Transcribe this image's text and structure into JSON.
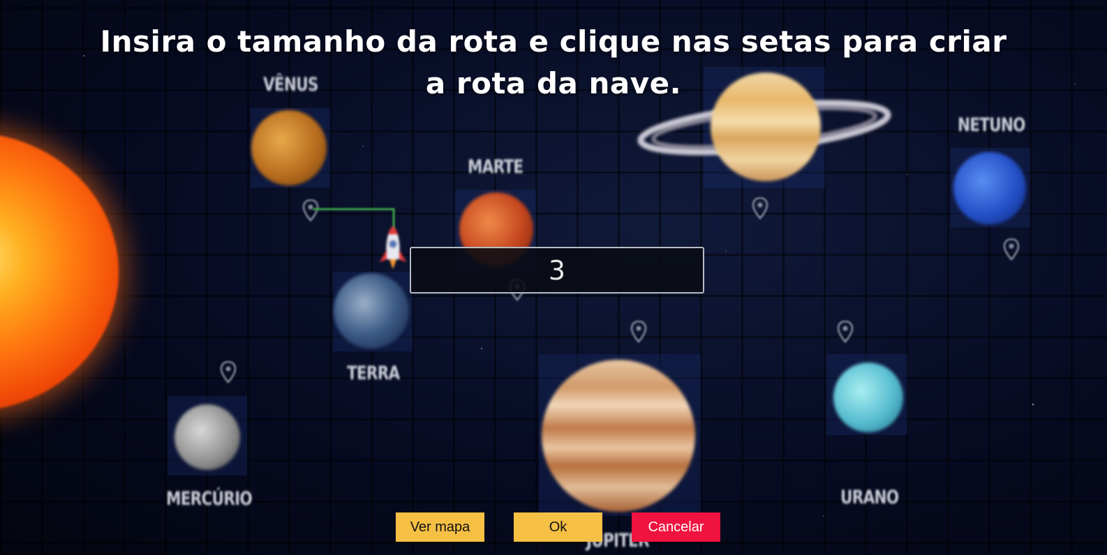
{
  "instruction": {
    "line1": "Insira o tamanho da rota e clique nas setas para criar",
    "line2": "a rota da nave."
  },
  "route_input": {
    "value": "3"
  },
  "buttons": {
    "map": "Ver mapa",
    "ok": "Ok",
    "cancel": "Cancelar"
  },
  "planets": {
    "venus": "VÊNUS",
    "marte": "MARTE",
    "terra": "TERRA",
    "mercurio": "MERCÚRIO",
    "jupiter": "JÚPITER",
    "netuno": "NETUNO",
    "urano": "URANO"
  },
  "colors": {
    "button_primary": "#f5c044",
    "button_cancel": "#f0123f",
    "route_line": "#3fa24a"
  }
}
